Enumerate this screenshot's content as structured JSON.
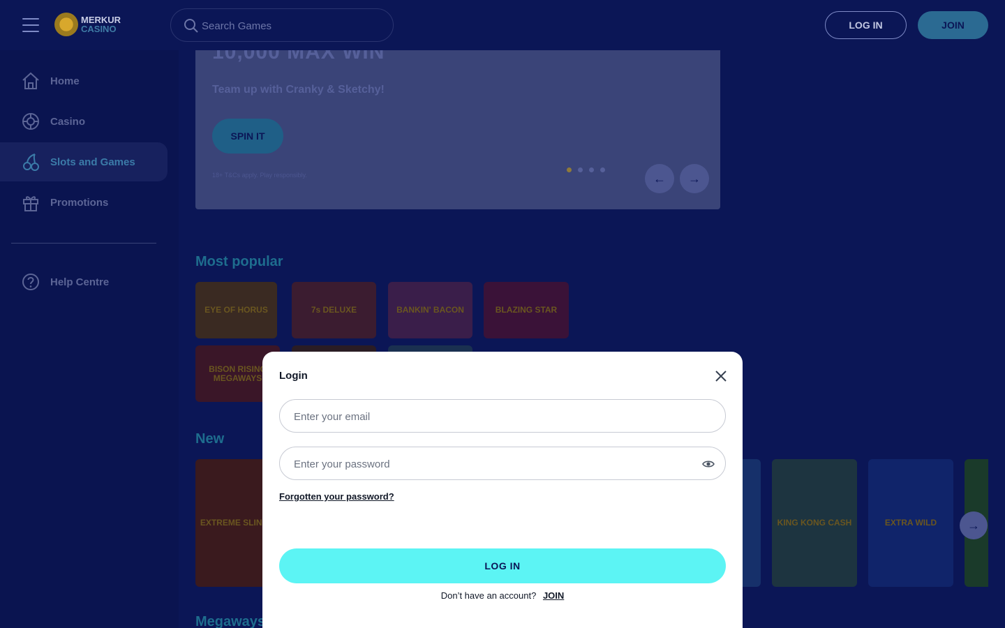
{
  "header": {
    "logo_line1": "MERKUR",
    "logo_line2": "CASINO",
    "search_placeholder": "Search Games",
    "login_label": "LOG IN",
    "join_label": "JOIN"
  },
  "sidebar": {
    "items": [
      {
        "label": "Home",
        "icon": "home-icon"
      },
      {
        "label": "Casino",
        "icon": "casino-chip-icon"
      },
      {
        "label": "Slots and Games",
        "icon": "cherries-icon"
      },
      {
        "label": "Promotions",
        "icon": "gift-icon"
      }
    ],
    "active_index": 2,
    "help_label": "Help Centre"
  },
  "hero": {
    "title": "10,000 MAX WIN",
    "subtitle": "Team up with Cranky & Sketchy!",
    "cta_label": "SPIN IT",
    "terms": "18+ T&Cs apply. Play responsibly.",
    "slide_count": 4,
    "active_slide": 1,
    "prev_arrow": "←",
    "next_arrow": "→"
  },
  "sections": {
    "most_popular": "Most popular",
    "new": "New",
    "megaways": "Megaways"
  },
  "popular_games": [
    {
      "name": "EYE OF HORUS",
      "color": "#3a2a22"
    },
    {
      "name": "7s DELUXE",
      "color": "#3b1c30"
    },
    {
      "name": "BANKIN' BACON",
      "color": "#3a1e4a"
    },
    {
      "name": "BLAZING STAR",
      "color": "#3a1238"
    },
    {
      "name": "BISON RISING MEGAWAYS",
      "color": "#3a1628"
    }
  ],
  "new_games": [
    {
      "name": "EXTREME SLINGO",
      "color": "#3a1a1e"
    },
    {
      "name": "KING KONG CASH",
      "color": "#1d3440"
    },
    {
      "name": "EXTRA WILD",
      "color": "#10246a"
    }
  ],
  "new_next_arrow": "→",
  "modal": {
    "title": "Login",
    "email_placeholder": "Enter your email",
    "password_placeholder": "Enter your password",
    "forgot_label": "Forgotten your password?",
    "login_label": "LOG IN",
    "signup_prompt": "Don’t have an account?",
    "signup_link": "JOIN"
  }
}
